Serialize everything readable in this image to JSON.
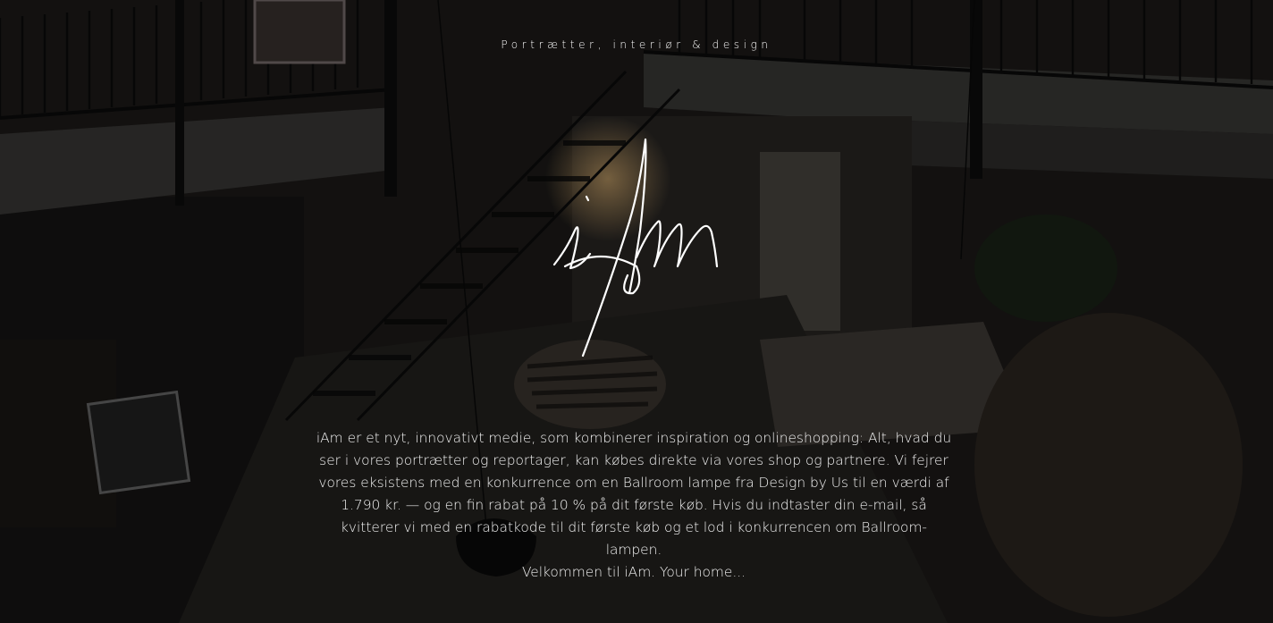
{
  "header": {
    "tagline": "Portrætter, interiør & design"
  },
  "logo": {
    "text": "iAm"
  },
  "intro": {
    "paragraph": "iAm er et nyt, innovativt medie, som kombinerer inspiration og onlineshopping: Alt, hvad du ser i vores portrætter og reportager, kan købes direkte via vores shop og partnere. Vi fejrer vores eksistens med en konkurrence om en Ballroom lampe fra Design by Us til en værdi af 1.790 kr. — og en fin rabat på 10 % på dit første køb. Hvis du indtaster din e-mail, så kvitterer vi med en rabatkode til dit første køb og et lod i konkurrencen om Ballroom-lampen.",
    "welcome": "Velkommen til iAm. Your home..."
  }
}
